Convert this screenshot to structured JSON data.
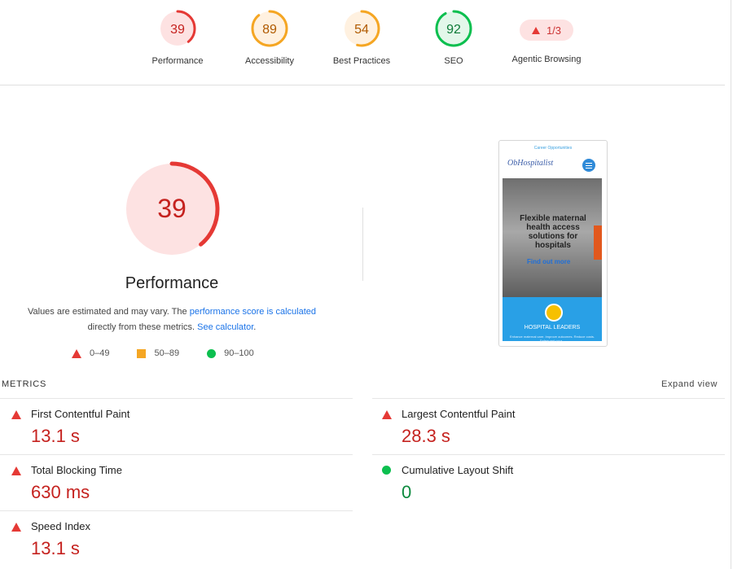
{
  "gauges": [
    {
      "score": "39",
      "label": "Performance",
      "level": 0.39,
      "color": "#e53935",
      "bg": "#fde2e2",
      "text_color": "#c5221f"
    },
    {
      "score": "89",
      "label": "Accessibility",
      "level": 0.89,
      "color": "#f5a623",
      "bg": "#fff1e0",
      "text_color": "#b05a00"
    },
    {
      "score": "54",
      "label": "Best Practices",
      "level": 0.54,
      "color": "#f5a623",
      "bg": "#fff1e0",
      "text_color": "#b05a00"
    },
    {
      "score": "92",
      "label": "SEO",
      "level": 0.92,
      "color": "#0cbf4f",
      "bg": "#e3f7ea",
      "text_color": "#0d7a37"
    }
  ],
  "agentic": {
    "value": "1/3",
    "label": "Agentic Browsing"
  },
  "main": {
    "score": "39",
    "level": 0.39,
    "title": "Performance",
    "desc_1": "Values are estimated and may vary. The ",
    "link_score": "performance score is calculated",
    "desc_2": " directly from these metrics. ",
    "link_calc": "See calculator",
    "desc_3": "."
  },
  "legend": [
    "0–49",
    "50–89",
    "90–100"
  ],
  "screenshot": {
    "top_text": "Career Opportunities",
    "logo": "ObHospitalist",
    "hero": "Flexible maternal health access solutions for hospitals",
    "cta": "Find out more",
    "section": "HOSPITAL LEADERS",
    "section_sub": "Enhance maternal care. Improve outcomes. Reduce costs. Safeguard your..."
  },
  "metrics_header": "METRICS",
  "expand_label": "Expand view",
  "metrics": [
    {
      "name": "First Contentful Paint",
      "value": "13.1 s",
      "status": "fail"
    },
    {
      "name": "Largest Contentful Paint",
      "value": "28.3 s",
      "status": "fail"
    },
    {
      "name": "Total Blocking Time",
      "value": "630 ms",
      "status": "fail"
    },
    {
      "name": "Cumulative Layout Shift",
      "value": "0",
      "status": "pass"
    },
    {
      "name": "Speed Index",
      "value": "13.1 s",
      "status": "fail"
    }
  ]
}
